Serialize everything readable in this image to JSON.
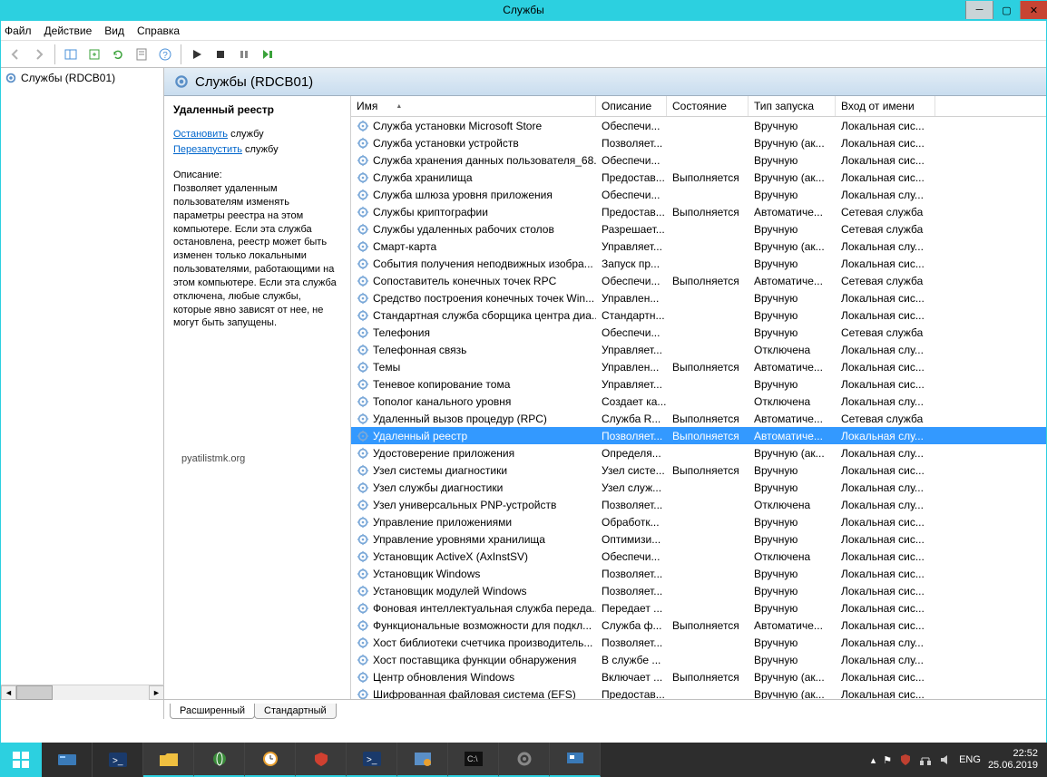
{
  "window": {
    "title": "Службы"
  },
  "menubar": [
    "Файл",
    "Действие",
    "Вид",
    "Справка"
  ],
  "tree": {
    "root": "Службы (RDCB01)"
  },
  "panel_header": "Службы (RDCB01)",
  "detail": {
    "selected_name": "Удаленный реестр",
    "stop_pre": "Остановить",
    "stop_post": " службу",
    "restart_pre": "Перезапустить",
    "restart_post": " службу",
    "desc_label": "Описание:",
    "description": "Позволяет удаленным пользователям изменять параметры реестра на этом компьютере. Если эта служба остановлена, реестр может быть изменен только локальными пользователями, работающими на этом компьютере. Если эта служба отключена, любые службы, которые явно зависят от нее, не могут быть запущены."
  },
  "columns": {
    "name": "Имя",
    "desc": "Описание",
    "state": "Состояние",
    "start": "Тип запуска",
    "logon": "Вход от имени"
  },
  "tabs": {
    "extended": "Расширенный",
    "standard": "Стандартный"
  },
  "services": [
    {
      "n": "Служба установки Microsoft Store",
      "d": "Обеспечи...",
      "s": "",
      "t": "Вручную",
      "l": "Локальная сис..."
    },
    {
      "n": "Служба установки устройств",
      "d": "Позволяет...",
      "s": "",
      "t": "Вручную (ак...",
      "l": "Локальная сис..."
    },
    {
      "n": "Служба хранения данных пользователя_68...",
      "d": "Обеспечи...",
      "s": "",
      "t": "Вручную",
      "l": "Локальная сис..."
    },
    {
      "n": "Служба хранилища",
      "d": "Предостав...",
      "s": "Выполняется",
      "t": "Вручную (ак...",
      "l": "Локальная сис..."
    },
    {
      "n": "Служба шлюза уровня приложения",
      "d": "Обеспечи...",
      "s": "",
      "t": "Вручную",
      "l": "Локальная слу..."
    },
    {
      "n": "Службы криптографии",
      "d": "Предостав...",
      "s": "Выполняется",
      "t": "Автоматиче...",
      "l": "Сетевая служба"
    },
    {
      "n": "Службы удаленных рабочих столов",
      "d": "Разрешает...",
      "s": "",
      "t": "Вручную",
      "l": "Сетевая служба"
    },
    {
      "n": "Смарт-карта",
      "d": "Управляет...",
      "s": "",
      "t": "Вручную (ак...",
      "l": "Локальная слу..."
    },
    {
      "n": "События получения неподвижных изобра...",
      "d": "Запуск пр...",
      "s": "",
      "t": "Вручную",
      "l": "Локальная сис..."
    },
    {
      "n": "Сопоставитель конечных точек RPC",
      "d": "Обеспечи...",
      "s": "Выполняется",
      "t": "Автоматиче...",
      "l": "Сетевая служба"
    },
    {
      "n": "Средство построения конечных точек Win...",
      "d": "Управлен...",
      "s": "",
      "t": "Вручную",
      "l": "Локальная сис..."
    },
    {
      "n": "Стандартная служба сборщика центра диа...",
      "d": "Стандартн...",
      "s": "",
      "t": "Вручную",
      "l": "Локальная сис..."
    },
    {
      "n": "Телефония",
      "d": "Обеспечи...",
      "s": "",
      "t": "Вручную",
      "l": "Сетевая служба"
    },
    {
      "n": "Телефонная связь",
      "d": "Управляет...",
      "s": "",
      "t": "Отключена",
      "l": "Локальная слу..."
    },
    {
      "n": "Темы",
      "d": "Управлен...",
      "s": "Выполняется",
      "t": "Автоматиче...",
      "l": "Локальная сис..."
    },
    {
      "n": "Теневое копирование тома",
      "d": "Управляет...",
      "s": "",
      "t": "Вручную",
      "l": "Локальная сис..."
    },
    {
      "n": "Тополог канального уровня",
      "d": "Создает ка...",
      "s": "",
      "t": "Отключена",
      "l": "Локальная слу..."
    },
    {
      "n": "Удаленный вызов процедур (RPC)",
      "d": "Служба R...",
      "s": "Выполняется",
      "t": "Автоматиче...",
      "l": "Сетевая служба"
    },
    {
      "n": "Удаленный реестр",
      "d": "Позволяет...",
      "s": "Выполняется",
      "t": "Автоматиче...",
      "l": "Локальная слу...",
      "sel": true
    },
    {
      "n": "Удостоверение приложения",
      "d": "Определя...",
      "s": "",
      "t": "Вручную (ак...",
      "l": "Локальная слу..."
    },
    {
      "n": "Узел системы диагностики",
      "d": "Узел систе...",
      "s": "Выполняется",
      "t": "Вручную",
      "l": "Локальная сис..."
    },
    {
      "n": "Узел службы диагностики",
      "d": "Узел служ...",
      "s": "",
      "t": "Вручную",
      "l": "Локальная слу..."
    },
    {
      "n": "Узел универсальных PNP-устройств",
      "d": "Позволяет...",
      "s": "",
      "t": "Отключена",
      "l": "Локальная слу..."
    },
    {
      "n": "Управление приложениями",
      "d": "Обработк...",
      "s": "",
      "t": "Вручную",
      "l": "Локальная сис..."
    },
    {
      "n": "Управление уровнями хранилища",
      "d": "Оптимизи...",
      "s": "",
      "t": "Вручную",
      "l": "Локальная сис..."
    },
    {
      "n": "Установщик ActiveX (AxInstSV)",
      "d": "Обеспечи...",
      "s": "",
      "t": "Отключена",
      "l": "Локальная сис..."
    },
    {
      "n": "Установщик Windows",
      "d": "Позволяет...",
      "s": "",
      "t": "Вручную",
      "l": "Локальная сис..."
    },
    {
      "n": "Установщик модулей Windows",
      "d": "Позволяет...",
      "s": "",
      "t": "Вручную",
      "l": "Локальная сис..."
    },
    {
      "n": "Фоновая интеллектуальная служба переда...",
      "d": "Передает ...",
      "s": "",
      "t": "Вручную",
      "l": "Локальная сис..."
    },
    {
      "n": "Функциональные возможности для подкл...",
      "d": "Служба ф...",
      "s": "Выполняется",
      "t": "Автоматиче...",
      "l": "Локальная сис..."
    },
    {
      "n": "Хост библиотеки счетчика производитель...",
      "d": "Позволяет...",
      "s": "",
      "t": "Вручную",
      "l": "Локальная слу..."
    },
    {
      "n": "Хост поставщика функции обнаружения",
      "d": "В службе ...",
      "s": "",
      "t": "Вручную",
      "l": "Локальная слу..."
    },
    {
      "n": "Центр обновления Windows",
      "d": "Включает ...",
      "s": "Выполняется",
      "t": "Вручную (ак...",
      "l": "Локальная сис..."
    },
    {
      "n": "Шифрованная файловая система (EFS)",
      "d": "Предостав...",
      "s": "",
      "t": "Вручную (ак...",
      "l": "Локальная сис..."
    }
  ],
  "tray": {
    "lang": "ENG",
    "time": "22:52",
    "date": "25.06.2019"
  },
  "watermark": "pyatilistmk.org"
}
